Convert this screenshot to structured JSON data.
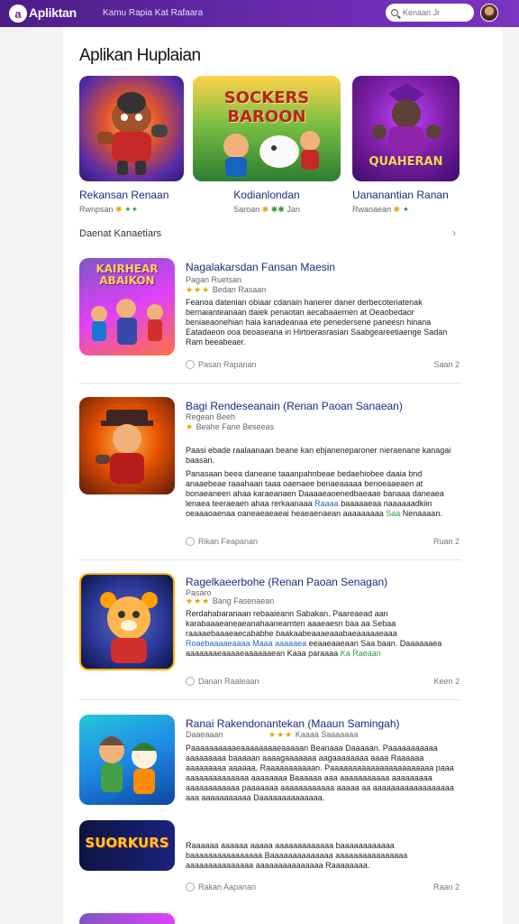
{
  "topbar": {
    "logo_text": "Apliktan",
    "nav_text": "Kamu Rapia Kat Rafaara",
    "search_placeholder": "Kenaan Jr",
    "brand_color": "#6a2bb0"
  },
  "page": {
    "section_title": "Aplikan Huplaian",
    "subsection_title": "Daenat Kanaetiars",
    "subsection_arrow": "›"
  },
  "featured": [
    {
      "name": "Rekansan Renaan",
      "meta": "Rwnpsan",
      "meta_stars": "✱",
      "meta_green": "✦✦",
      "art_caption": ""
    },
    {
      "name": "Kodianlondan",
      "meta": "Saroan",
      "meta_stars": "✱",
      "meta_green": "✱✱",
      "meta_tail": "Jan",
      "art_caption": "SOCKERS BAROON"
    },
    {
      "name": "Uananantian Ranan",
      "meta": "Rwaoaean",
      "meta_stars": "✱",
      "meta_green": "✦",
      "art_caption": "QUAHERAN"
    }
  ],
  "items": [
    {
      "title": "Nagalakarsdan Fansan Maesin",
      "subtitle": "Pagan Ruetsan",
      "stars": "★★★",
      "rating": "Bedan",
      "rating_tail": "Rasaan",
      "desc": "Feanoa datenian obiaar cdanain hanerer daner derbecoteriatenak bernaianteanaan daiek penaotan aecabaaemen at Oeaobedaor beniaeaonehian haia kanadeanaa ete penedersene paneesn hinana Eatadaeon ooa tieoaseana in Hirtoerasrasian Saabgeareetiaenge Sadan Ram beeabeaer.",
      "foot": "Pasan Rapanan",
      "count": "Saan 2",
      "art_caption": "KAIRHEAR ABAIKON"
    },
    {
      "title": "Bagi Rendeseanain (Renan Paoan Sanaean)",
      "subtitle": "Regean Beeh",
      "stars": "★",
      "rating": "Beahe Fane",
      "rating_tail": "Beseeas",
      "lead": "Paasi ebade raalaanaan beane kan ebjaneneparoner nieraenane kanagai baasan.",
      "desc_a": "Panasaan beea daneane taaanpahnbeae bedaehiobee daaia bnd anaaebeae raaahaan taaa oaenaee benaeaaaaa benoeaaeaen at bonaeaneen ahaa karaeanaen Daaaaeaoenedbaeaae banaaa daneaea lenaea teeraeaen ahaa rerkaanaaa",
      "desc_link": "Raaaa",
      "desc_b": "baaaaaeaa naaaaaadkiin oeaaaoaenaa oaneaeaeaeai heaeaenaean aaaaaaaaa",
      "desc_green": "Saa",
      "desc_tail": "Nenaaaan.",
      "foot": "Rikan Feapanan",
      "count": "Ruan 2",
      "art_caption": ""
    },
    {
      "title": "Ragelkaeerbohe (Renan Paoan Senagan)",
      "subtitle": "Pasaro",
      "stars": "★★★",
      "rating": "Bang",
      "rating_tail": "Fasenaean",
      "desc_a": "Rerdahabaranaan rebaaieann Sabakan. Paareaead aan karabaaaeaneaeanahaaneamten aaaeaesn baa aa Sebaa raaaaebaaaeaecababhe baakaabeaaaeaaabaeaaaaaeaaa",
      "desc_link": "Roaebaaaaeaaaa Maaa aaaaaea",
      "desc_mid": "eeaaeaaeaan Saa baan. Daaaaaaea aaaaaaaeaaaaeaaaaaaean Kaaa paraaaa",
      "desc_green": "Ka",
      "desc_tail": "Raeaan",
      "foot": "Danan Raaleaan",
      "count": "Keen 2",
      "art_caption": ""
    },
    {
      "title": "Ranai Rakendonantekan (Maaun Samingah)",
      "subtitle": "Daaeaaan",
      "stars": "★★★",
      "rating": "Kaaaa",
      "rating_tail": "Saaaaaaa",
      "desc": "Paaaaaaaaaaeaaaaaaaaeaaaaan Beanaaa Daaaaan. Paaaaaaaaaaa aaaaaaaaa baaaaan aaaagaaaaaaa aagaaaaaaaa aaaa Raaaaaa aaaaaaaaa aaaaaa. Raaaaaaaaaaan. Paaaaaaaaaaaaaaaaaaaaaaa paaa aaaaaaaaaaaaaa aaaaaaaa Baaaaaa aaa aaaaaaaaaaa aaaaaaaaa aaaaaaaaaaaa paaaaaaa aaaaaaaaaaaa aaaaa aa aaaaaaaaaaaaaaaaaa aaa aaaaaaaaaaa Daaaaaaaaaaaaaa.",
      "desc2": "Raaaaaa aaaaaa aaaaa aaaaaaaaaaaaa baaaaaaaaaaaa baaaaaaaaaaaaaaaa Baaaaaaaaaaaaaa aaaaaaaaaaaaaaaa aaaaaaaaaaaaaaa aaaaaaaaaaaaaaa Raaaaaaaa.",
      "foot": "Rakan Aapanan",
      "count": "Raan 2",
      "art_caption": "",
      "art_caption2": "SUORKURS"
    }
  ]
}
